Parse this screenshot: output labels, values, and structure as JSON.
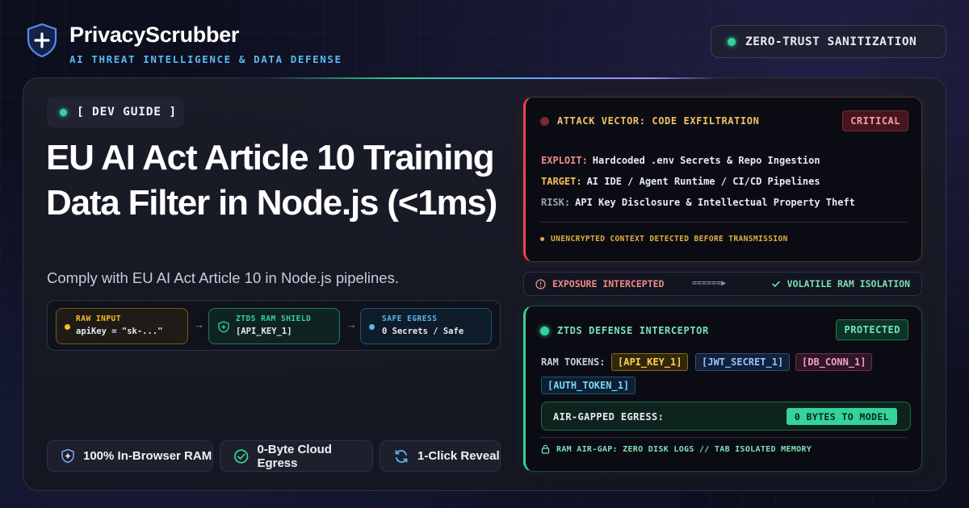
{
  "brand": {
    "name": "PrivacyScrubber",
    "tagline": "AI THREAT INTELLIGENCE & DATA DEFENSE",
    "icon": "shield-plus-icon"
  },
  "top_badge": {
    "label": "ZERO-TRUST SANITIZATION"
  },
  "hero": {
    "tag": "[ DEV GUIDE ]",
    "headline": "EU AI Act Article 10 Training Data Filter in Node.js (<1ms)",
    "subline": "Comply with EU AI Act Article 10 in Node.js pipelines."
  },
  "flow": {
    "raw": {
      "label": "RAW INPUT",
      "value": "apiKey = \"sk-...\""
    },
    "shield": {
      "label": "ZTDS RAM SHIELD",
      "value": "[API_KEY_1]"
    },
    "safe": {
      "label": "SAFE EGRESS",
      "value": "0 Secrets / Safe"
    },
    "arrow": "→"
  },
  "features": [
    {
      "label": "100% In-Browser RAM",
      "icon": "shield-icon"
    },
    {
      "label": "0-Byte Cloud Egress",
      "icon": "check-circle-icon"
    },
    {
      "label": "1-Click Reveal",
      "icon": "refresh-icon"
    }
  ],
  "attack": {
    "title": "ATTACK VECTOR: CODE EXFILTRATION",
    "severity": "CRITICAL",
    "exploit_key": "EXPLOIT:",
    "exploit_val": "Hardcoded .env Secrets & Repo Ingestion",
    "target_key": "TARGET:",
    "target_val": "AI IDE / Agent Runtime / CI/CD Pipelines",
    "risk_key": "RISK:",
    "risk_val": "API Key Disclosure & Intellectual Property Theft",
    "footer": "UNENCRYPTED CONTEXT DETECTED BEFORE TRANSMISSION"
  },
  "status": {
    "left": "EXPOSURE INTERCEPTED",
    "mid": "======▶",
    "right": "VOLATILE RAM ISOLATION"
  },
  "defense": {
    "title": "ZTDS DEFENSE INTERCEPTOR",
    "state": "PROTECTED",
    "tokens_label": "RAM TOKENS:",
    "tokens": [
      "[API_KEY_1]",
      "[JWT_SECRET_1]",
      "[DB_CONN_1]",
      "[AUTH_TOKEN_1]"
    ],
    "egress_label": "AIR-GAPPED EGRESS:",
    "egress_value": "0 BYTES TO MODEL",
    "footer": "RAM AIR-GAP: ZERO DISK LOGS // TAB ISOLATED MEMORY"
  },
  "colors": {
    "accent_green": "#34d399",
    "accent_blue": "#5ab8f0",
    "critical_red": "#ef4444",
    "warning_amber": "#fbbf24"
  }
}
